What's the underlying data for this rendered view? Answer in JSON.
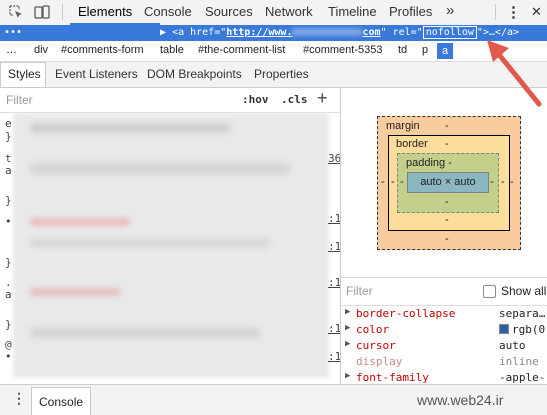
{
  "toolbar": {
    "tabs": [
      {
        "label": "Elements",
        "active": true
      },
      {
        "label": "Console"
      },
      {
        "label": "Sources"
      },
      {
        "label": "Network"
      },
      {
        "label": "Timeline"
      },
      {
        "label": "Profiles"
      }
    ],
    "more_label": "»",
    "menu_label": "⋮",
    "close_label": "✕"
  },
  "dom_line": {
    "dots": "•••",
    "arrow": "▶",
    "open": "<a href=\"",
    "href_start": "http://www.",
    "href_end": "com",
    "mid": "\" rel=\"",
    "rel": "nofollow",
    "close": "\">…</a>"
  },
  "breadcrumb": {
    "items": [
      "…",
      "div",
      "#comments-form",
      "table",
      "#the-comment-list",
      "#comment-5353",
      "td",
      "p",
      "a"
    ]
  },
  "subtabs": [
    "Styles",
    "Event Listeners",
    "DOM Breakpoints",
    "Properties"
  ],
  "styles": {
    "filter_placeholder": "Filter",
    "hov": ":hov",
    "cls": ".cls",
    "add": "+",
    "left_chars": [
      "e",
      "}",
      "t",
      "a",
      "}",
      "•",
      "}",
      ".",
      "a",
      "}",
      "@",
      "•"
    ],
    "right_nums": [
      "36",
      ":1",
      ":1",
      ":1",
      ":1",
      ":1"
    ]
  },
  "box_model": {
    "margin_label": "margin",
    "margin_top": "-",
    "margin_bottom": "-",
    "margin_left": "-",
    "margin_right": "-",
    "border_label": "border",
    "border_top": "-",
    "border_bottom": "-",
    "border_left": "-",
    "border_right": "-",
    "padding_label": "padding -",
    "padding_bottom": "-",
    "padding_left": "-",
    "padding_right": "-",
    "content": "auto × auto"
  },
  "computed": {
    "filter_placeholder": "Filter",
    "show_all_label": "Show all",
    "rows": [
      {
        "name": "border-collapse",
        "value": "separa…"
      },
      {
        "name": "color",
        "value": "rgb(0,"
      },
      {
        "name": "cursor",
        "value": "auto"
      },
      {
        "name": "display",
        "value": "inline"
      },
      {
        "name": "font-family",
        "value": "-apple-"
      }
    ]
  },
  "drawer": {
    "menu_label": "⋮",
    "console_label": "Console"
  },
  "watermark": "www.web24.ir",
  "colors": {
    "accent": "#3879d9",
    "margin": "#f9cc9d",
    "border": "#fddd9b",
    "padding": "#c3d08b",
    "content": "#8cb6c0",
    "arrow": "#e05a4b"
  }
}
